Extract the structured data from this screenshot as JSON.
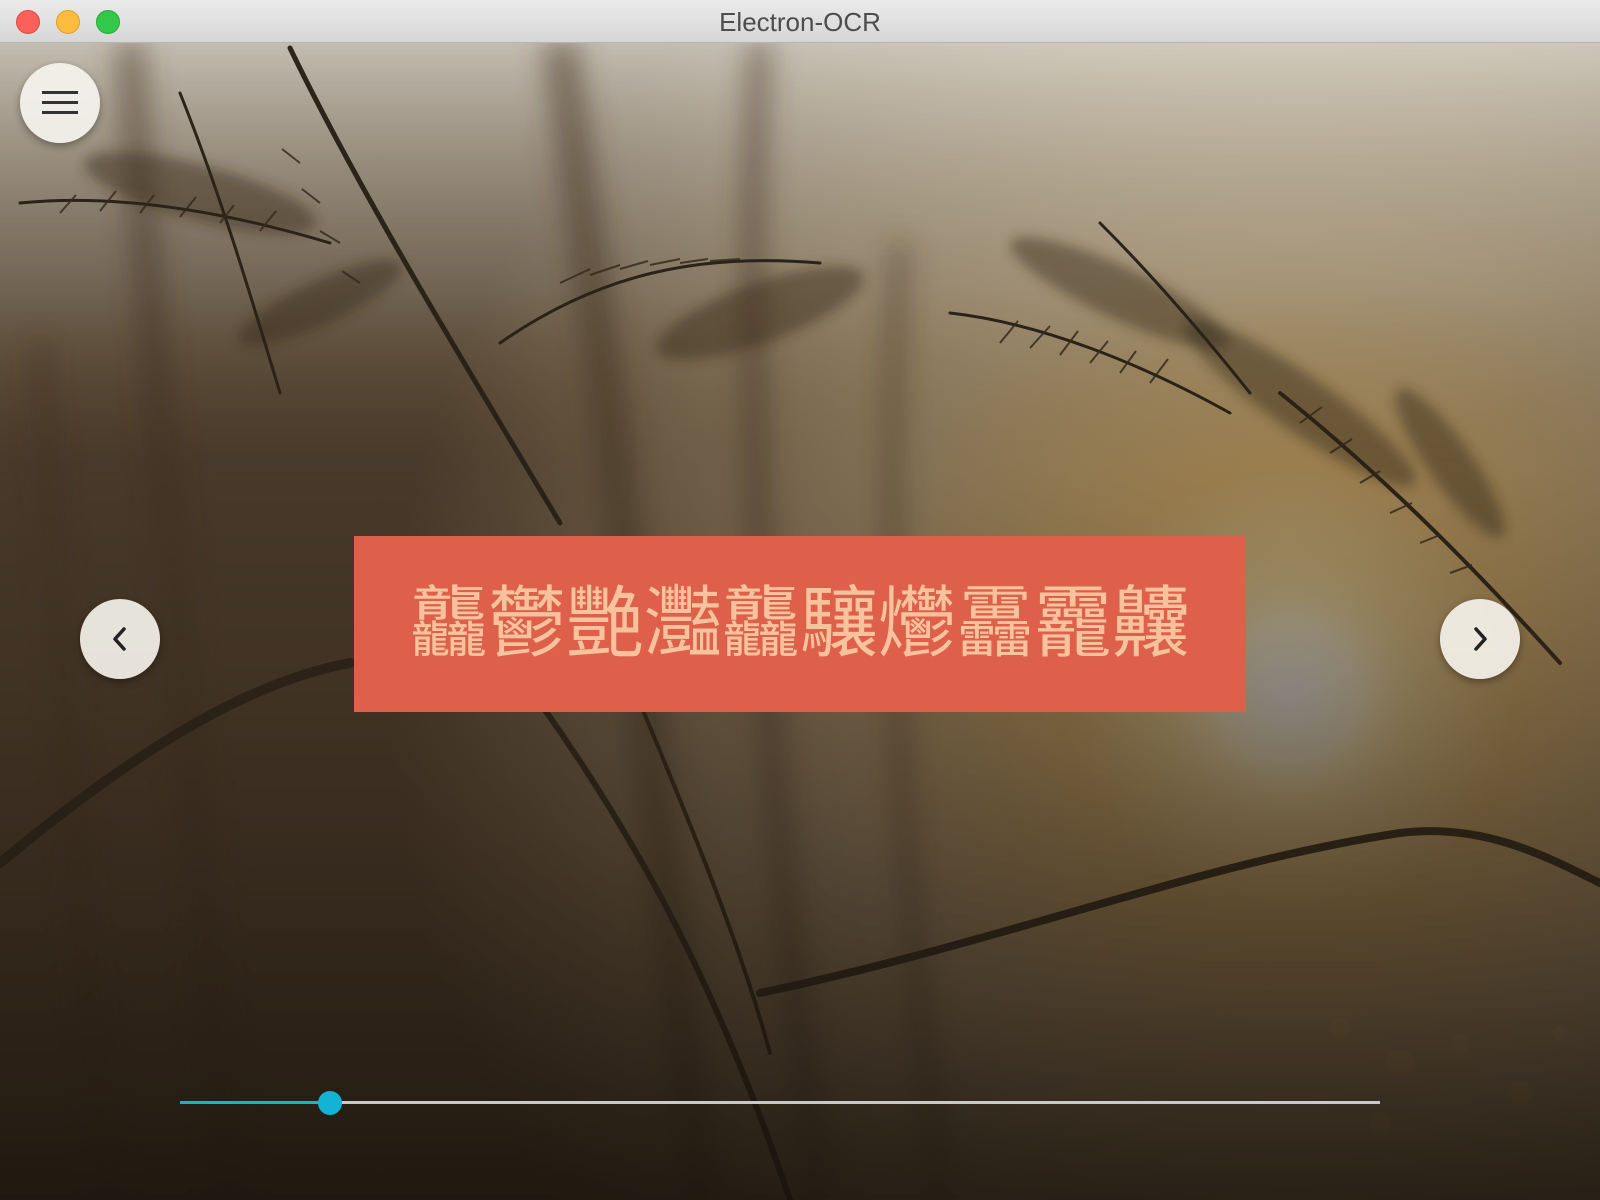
{
  "window": {
    "title": "Electron-OCR",
    "controls": [
      "close",
      "minimize",
      "maximize"
    ]
  },
  "menu_button": {
    "icon": "hamburger-menu-icon"
  },
  "navigation": {
    "prev_icon": "chevron-left-icon",
    "next_icon": "chevron-right-icon"
  },
  "banner": {
    "text": "龘鬱艷灩龘驤爩靐龗齉",
    "background_color": "#de604a",
    "text_color": "#f6c39c"
  },
  "slider": {
    "value": 0.125,
    "accent_color": "#12b3d4",
    "track_color": "#c9c9c9"
  },
  "background": {
    "description_icon": "grass-sunset-photo"
  }
}
